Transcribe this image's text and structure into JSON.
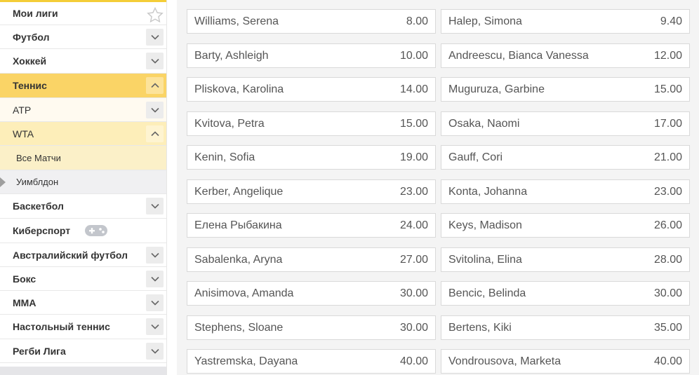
{
  "sidebar": {
    "my_leagues": "Мои лиги",
    "items": [
      {
        "label": "Футбол"
      },
      {
        "label": "Хоккей"
      },
      {
        "label": "Теннис"
      },
      {
        "label": "ATP"
      },
      {
        "label": "WTA"
      },
      {
        "label": "Все Матчи"
      },
      {
        "label": "Уимблдон"
      },
      {
        "label": "Баскетбол"
      },
      {
        "label": "Киберспорт"
      },
      {
        "label": "Австралийский футбол"
      },
      {
        "label": "Бокс"
      },
      {
        "label": "MMA"
      },
      {
        "label": "Настольный теннис"
      },
      {
        "label": "Регби Лига"
      }
    ]
  },
  "odds": [
    {
      "left": {
        "name": "Williams, Serena",
        "value": "8.00"
      },
      "right": {
        "name": "Halep, Simona",
        "value": "9.40"
      }
    },
    {
      "left": {
        "name": "Barty, Ashleigh",
        "value": "10.00"
      },
      "right": {
        "name": "Andreescu, Bianca Vanessa",
        "value": "12.00"
      }
    },
    {
      "left": {
        "name": "Pliskova, Karolina",
        "value": "14.00"
      },
      "right": {
        "name": "Muguruza, Garbine",
        "value": "15.00"
      }
    },
    {
      "left": {
        "name": "Kvitova, Petra",
        "value": "15.00"
      },
      "right": {
        "name": "Osaka, Naomi",
        "value": "17.00"
      }
    },
    {
      "left": {
        "name": "Kenin, Sofia",
        "value": "19.00"
      },
      "right": {
        "name": "Gauff, Cori",
        "value": "21.00"
      }
    },
    {
      "left": {
        "name": "Kerber, Angelique",
        "value": "23.00"
      },
      "right": {
        "name": "Konta, Johanna",
        "value": "23.00"
      }
    },
    {
      "left": {
        "name": "Елена Рыбакина",
        "value": "24.00"
      },
      "right": {
        "name": "Keys, Madison",
        "value": "26.00"
      }
    },
    {
      "left": {
        "name": "Sabalenka, Aryna",
        "value": "27.00"
      },
      "right": {
        "name": "Svitolina, Elina",
        "value": "28.00"
      }
    },
    {
      "left": {
        "name": "Anisimova, Amanda",
        "value": "30.00"
      },
      "right": {
        "name": "Bencic, Belinda",
        "value": "30.00"
      }
    },
    {
      "left": {
        "name": "Stephens, Sloane",
        "value": "30.00"
      },
      "right": {
        "name": "Bertens, Kiki",
        "value": "35.00"
      }
    },
    {
      "left": {
        "name": "Yastremska, Dayana",
        "value": "40.00"
      },
      "right": {
        "name": "Vondrousova, Marketa",
        "value": "40.00"
      }
    }
  ],
  "colors": {
    "accent": "#f4cd38",
    "active_row": "#fad466",
    "open_row": "#fdeeb9",
    "selected_leaf": "#fbf0c8"
  }
}
